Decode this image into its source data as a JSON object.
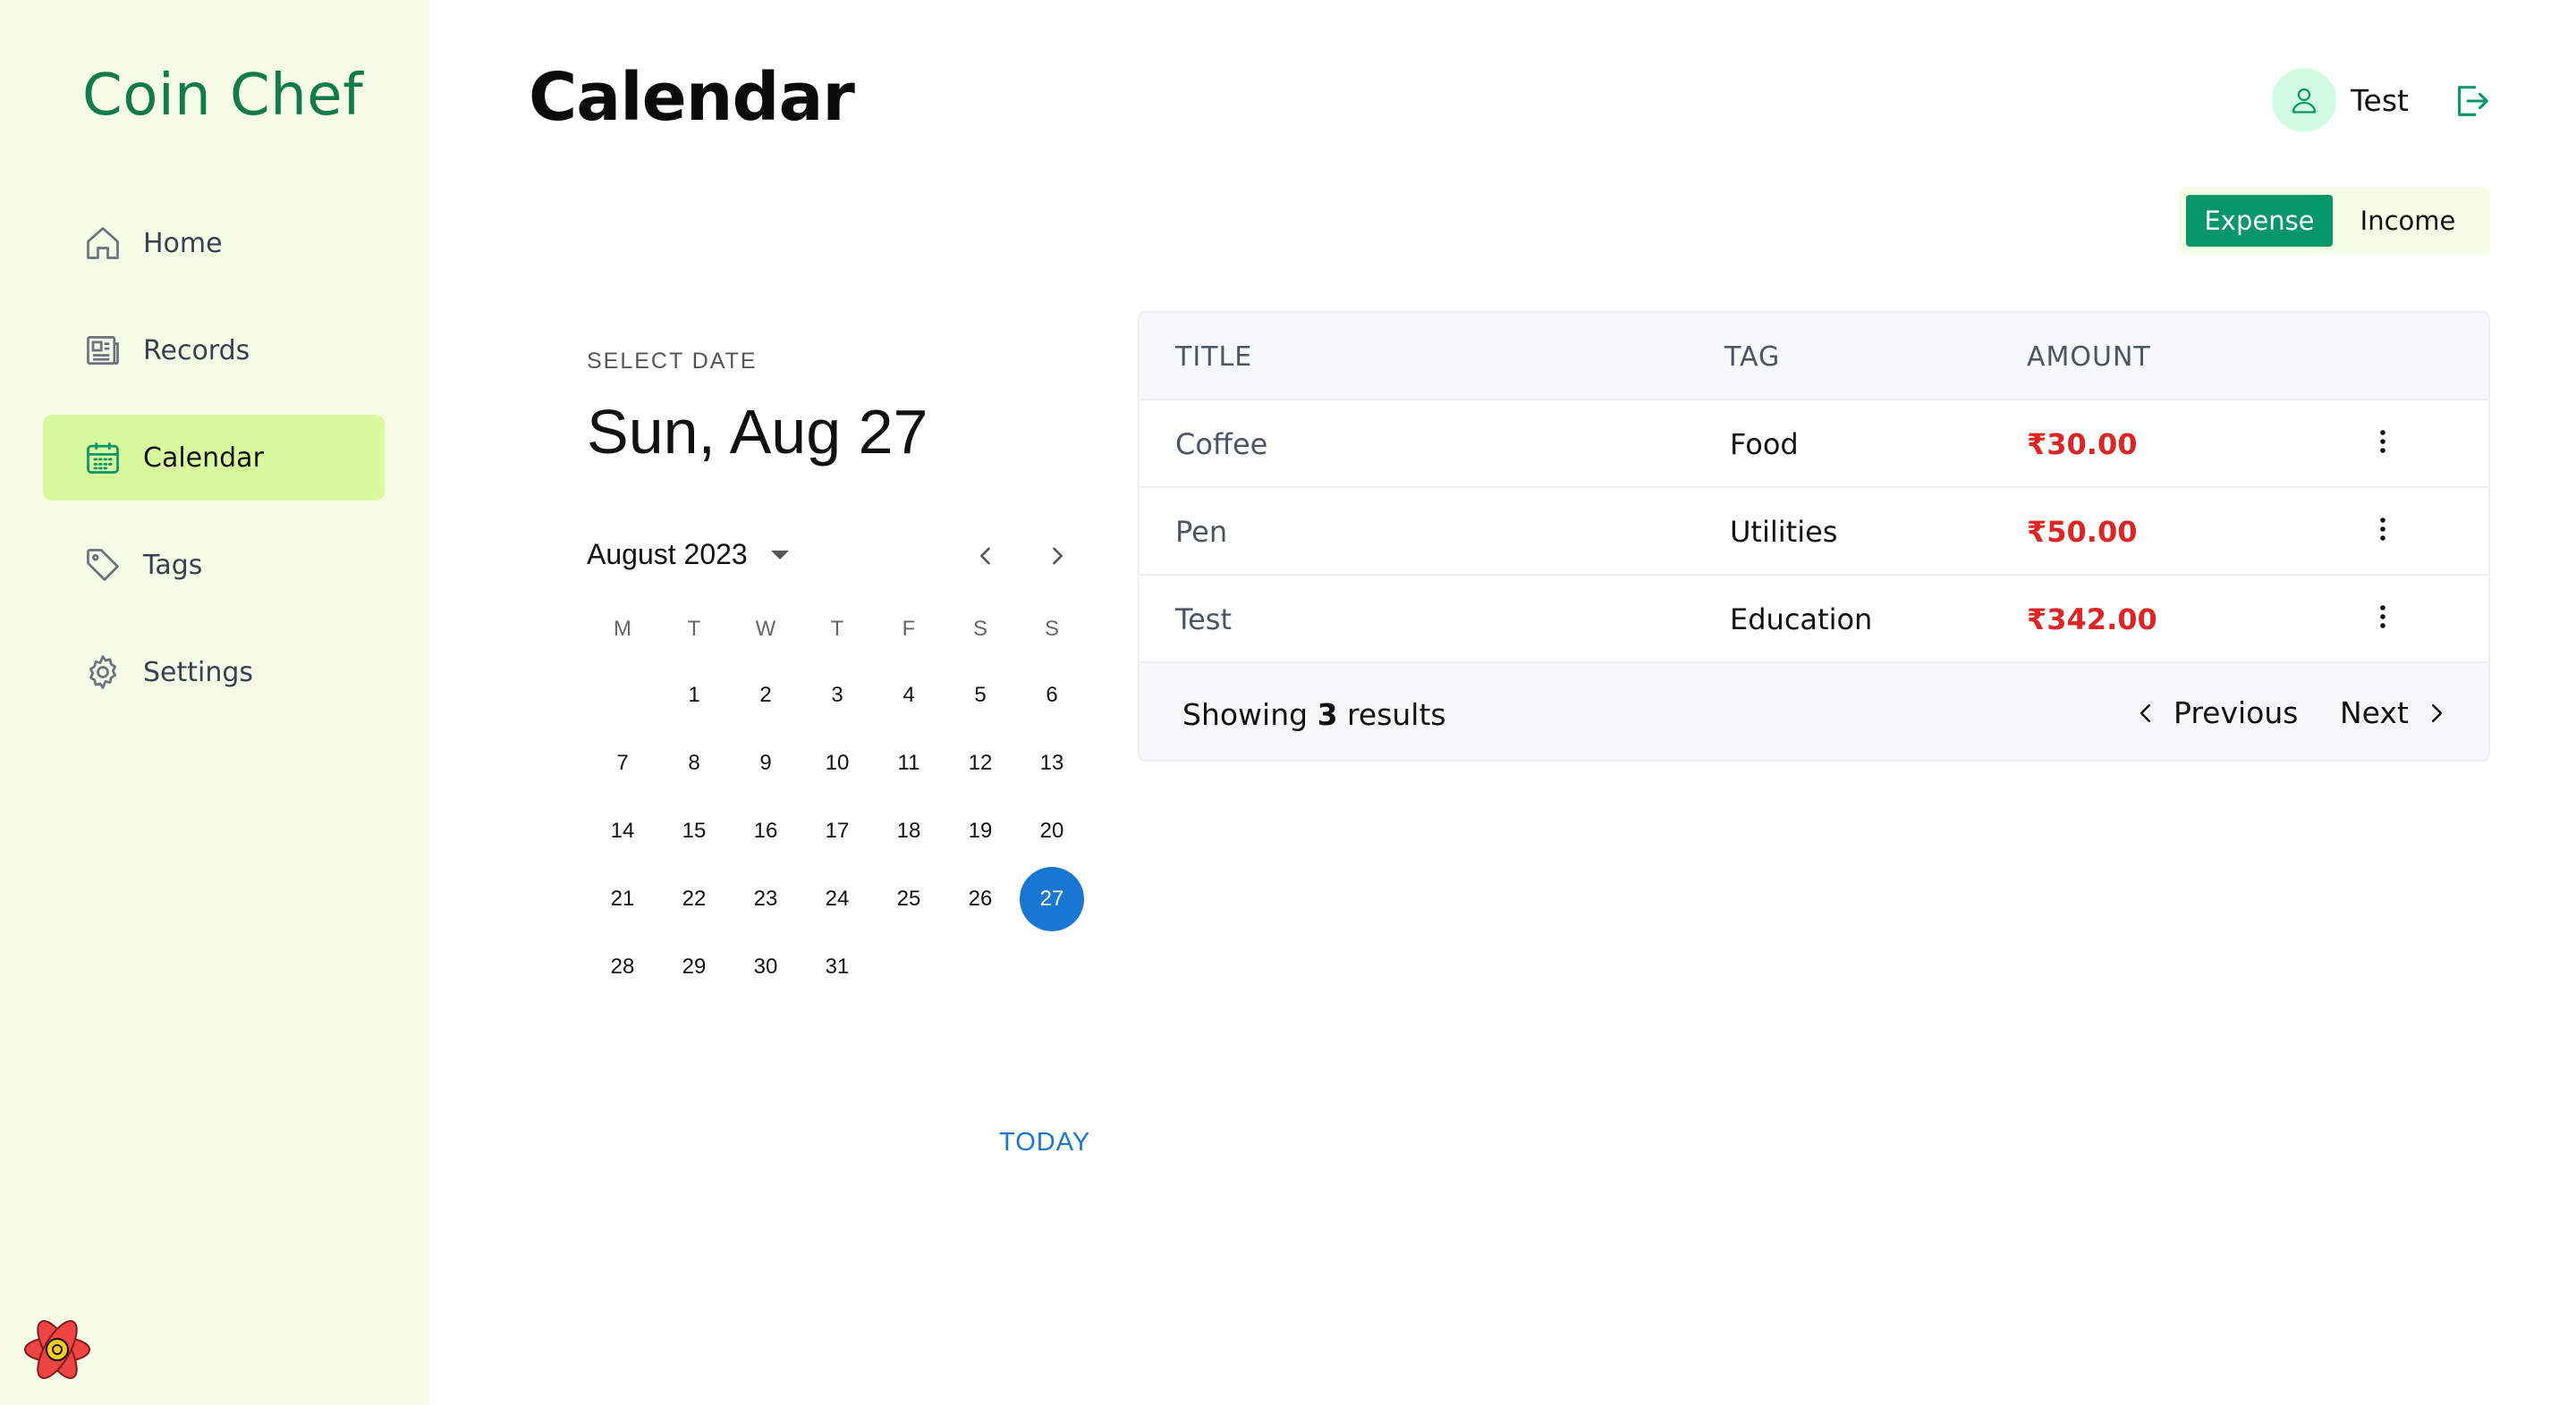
{
  "app": {
    "brand": "Coin Chef"
  },
  "sidebar": {
    "items": [
      {
        "label": "Home",
        "icon": "home-icon",
        "active": false
      },
      {
        "label": "Records",
        "icon": "newspaper-icon",
        "active": false
      },
      {
        "label": "Calendar",
        "icon": "calendar-icon",
        "active": true
      },
      {
        "label": "Tags",
        "icon": "tag-icon",
        "active": false
      },
      {
        "label": "Settings",
        "icon": "gear-icon",
        "active": false
      }
    ]
  },
  "header": {
    "title": "Calendar",
    "user_name": "Test"
  },
  "toggle": {
    "expense": "Expense",
    "income": "Income",
    "selected": "Expense"
  },
  "picker": {
    "select_label": "SELECT DATE",
    "selected_date": "Sun, Aug 27",
    "month_label": "August 2023",
    "weekdays": [
      "M",
      "T",
      "W",
      "T",
      "F",
      "S",
      "S"
    ],
    "first_weekday_offset": 1,
    "days_in_month": 31,
    "selected_day": 27,
    "today_label": "TODAY"
  },
  "table": {
    "headers": {
      "title": "TITLE",
      "tag": "TAG",
      "amount": "AMOUNT"
    },
    "rows": [
      {
        "title": "Coffee",
        "tag": "Food",
        "amount": "₹30.00"
      },
      {
        "title": "Pen",
        "tag": "Utilities",
        "amount": "₹50.00"
      },
      {
        "title": "Test",
        "tag": "Education",
        "amount": "₹342.00"
      }
    ],
    "footer": {
      "showing": "Showing",
      "count": "3",
      "results": "results",
      "previous": "Previous",
      "next": "Next"
    }
  },
  "colors": {
    "accent": "#059669",
    "sidebar_bg": "#f5fde6",
    "active_nav": "#d9f99d",
    "amount": "#dc2626",
    "selected_day": "#1976d2"
  }
}
